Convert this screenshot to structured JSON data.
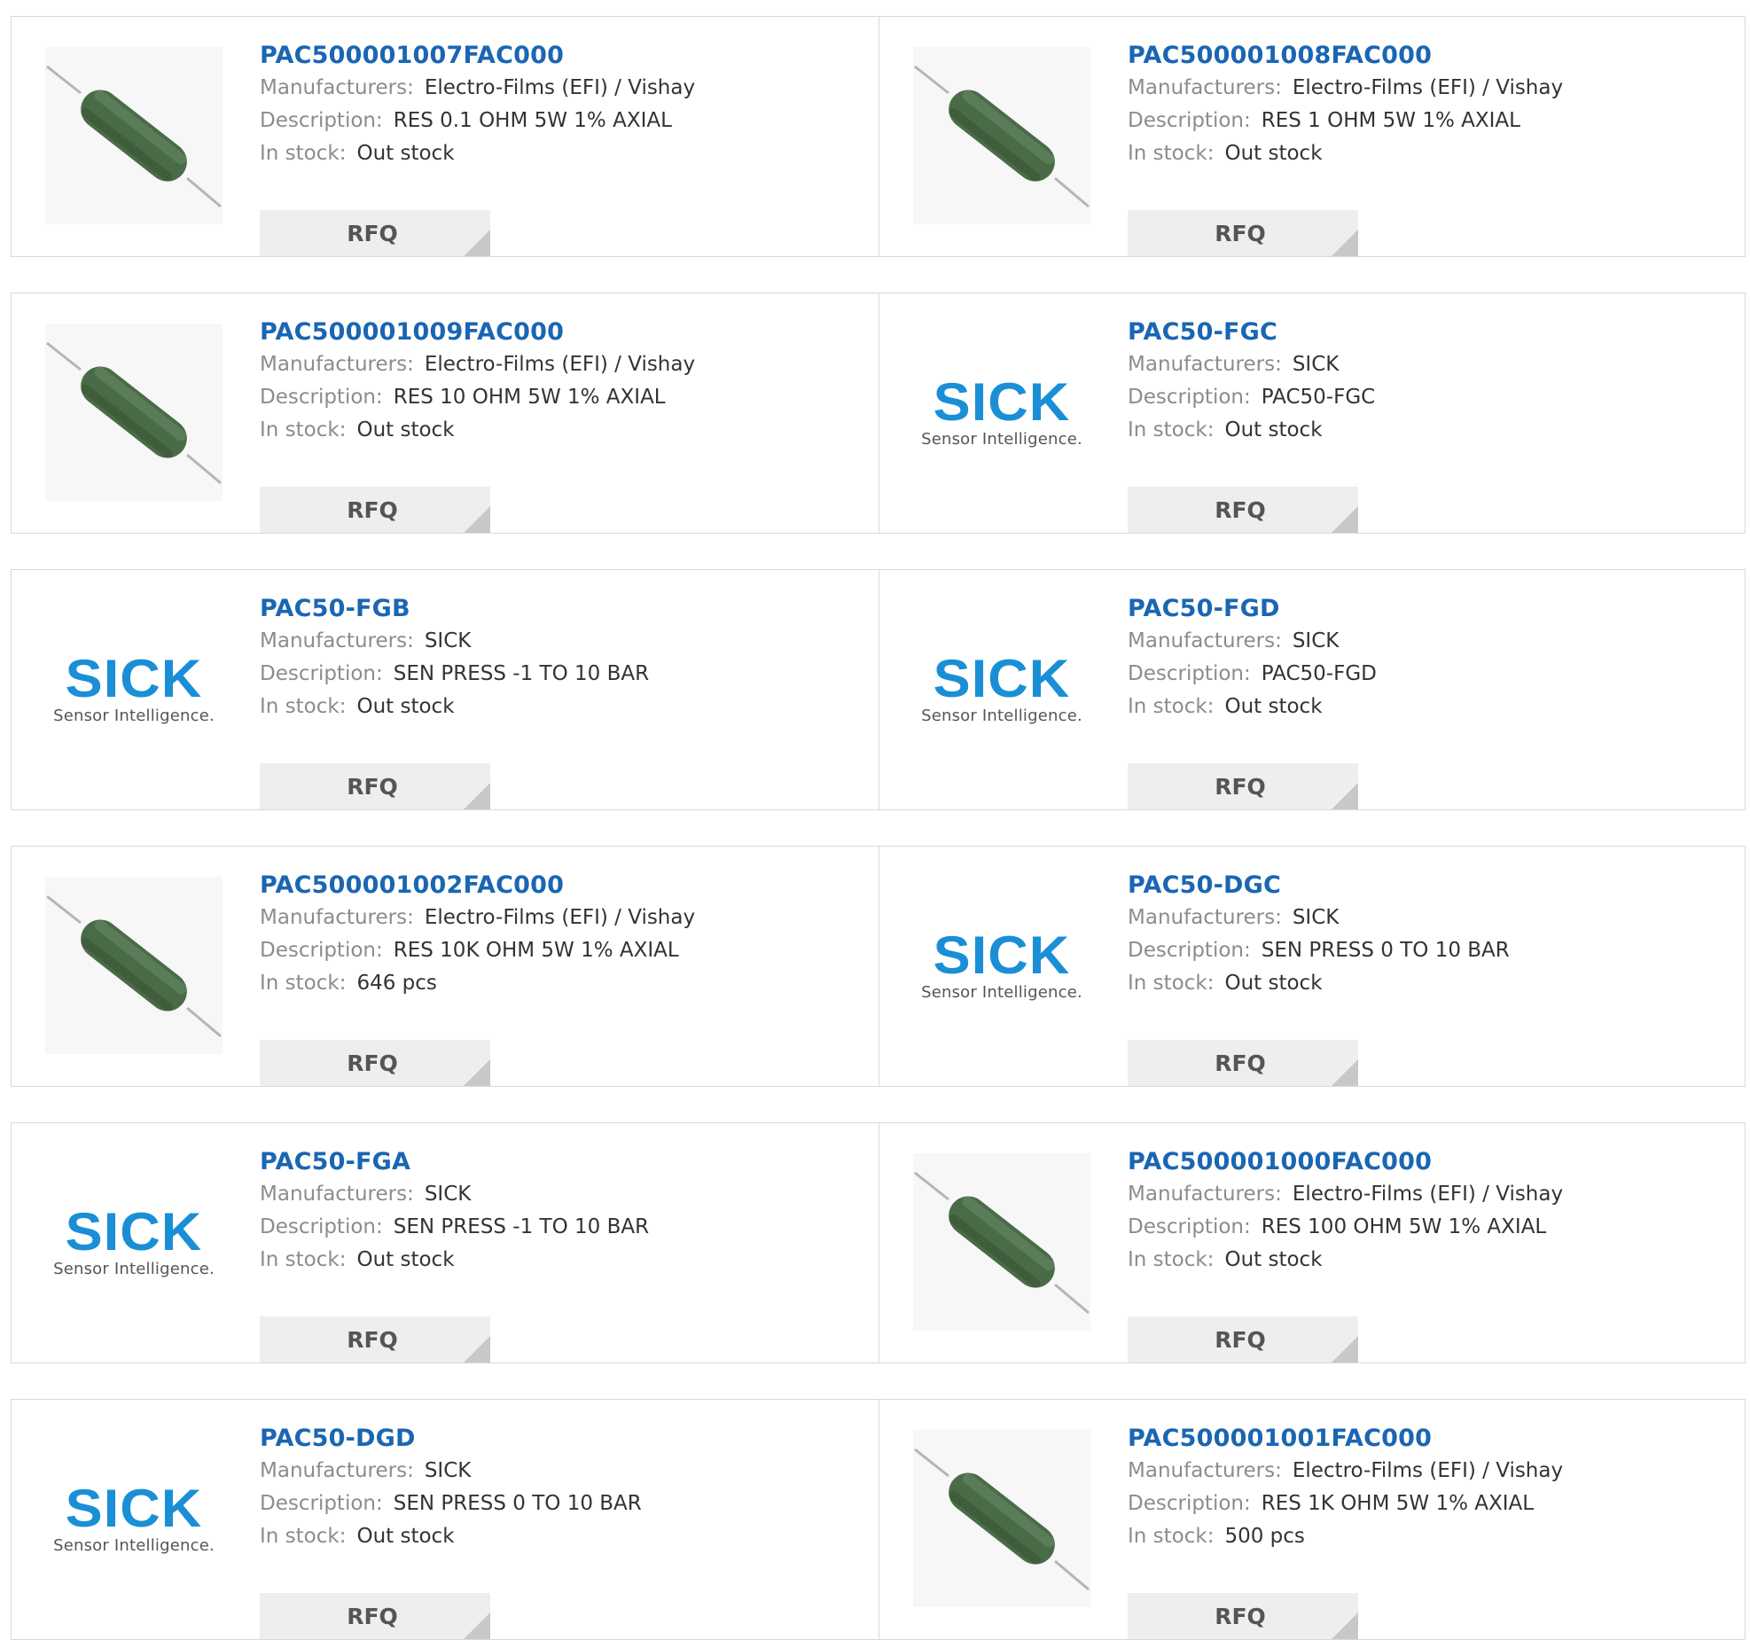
{
  "labels": {
    "manufacturers": "Manufacturers:",
    "description": "Description:",
    "in_stock": "In stock:",
    "rfq": "RFQ"
  },
  "brand": {
    "sick_word": "SICK",
    "sick_tagline": "Sensor Intelligence."
  },
  "colors": {
    "part_link": "#1a66b3",
    "sick_blue": "#1a8fd6",
    "resistor_green": "#4a6b47"
  },
  "products": [
    {
      "part": "PAC500001007FAC000",
      "manufacturer": "Electro-Films (EFI) / Vishay",
      "description": "RES 0.1 OHM 5W 1% AXIAL",
      "stock": "Out stock",
      "image": "resistor"
    },
    {
      "part": "PAC500001008FAC000",
      "manufacturer": "Electro-Films (EFI) / Vishay",
      "description": "RES 1 OHM 5W 1% AXIAL",
      "stock": "Out stock",
      "image": "resistor"
    },
    {
      "part": "PAC500001009FAC000",
      "manufacturer": "Electro-Films (EFI) / Vishay",
      "description": "RES 10 OHM 5W 1% AXIAL",
      "stock": "Out stock",
      "image": "resistor"
    },
    {
      "part": "PAC50-FGC",
      "manufacturer": "SICK",
      "description": "PAC50-FGC",
      "stock": "Out stock",
      "image": "sick-logo"
    },
    {
      "part": "PAC50-FGB",
      "manufacturer": "SICK",
      "description": "SEN PRESS -1 TO 10 BAR",
      "stock": "Out stock",
      "image": "sick-logo"
    },
    {
      "part": "PAC50-FGD",
      "manufacturer": "SICK",
      "description": "PAC50-FGD",
      "stock": "Out stock",
      "image": "sick-logo"
    },
    {
      "part": "PAC500001002FAC000",
      "manufacturer": "Electro-Films (EFI) / Vishay",
      "description": "RES 10K OHM 5W 1% AXIAL",
      "stock": "646 pcs",
      "image": "resistor"
    },
    {
      "part": "PAC50-DGC",
      "manufacturer": "SICK",
      "description": "SEN PRESS 0 TO 10 BAR",
      "stock": "Out stock",
      "image": "sick-logo"
    },
    {
      "part": "PAC50-FGA",
      "manufacturer": "SICK",
      "description": "SEN PRESS -1 TO 10 BAR",
      "stock": "Out stock",
      "image": "sick-logo"
    },
    {
      "part": "PAC500001000FAC000",
      "manufacturer": "Electro-Films (EFI) / Vishay",
      "description": "RES 100 OHM 5W 1% AXIAL",
      "stock": "Out stock",
      "image": "resistor"
    },
    {
      "part": "PAC50-DGD",
      "manufacturer": "SICK",
      "description": "SEN PRESS 0 TO 10 BAR",
      "stock": "Out stock",
      "image": "sick-logo"
    },
    {
      "part": "PAC500001001FAC000",
      "manufacturer": "Electro-Films (EFI) / Vishay",
      "description": "RES 1K OHM 5W 1% AXIAL",
      "stock": "500 pcs",
      "image": "resistor"
    }
  ]
}
